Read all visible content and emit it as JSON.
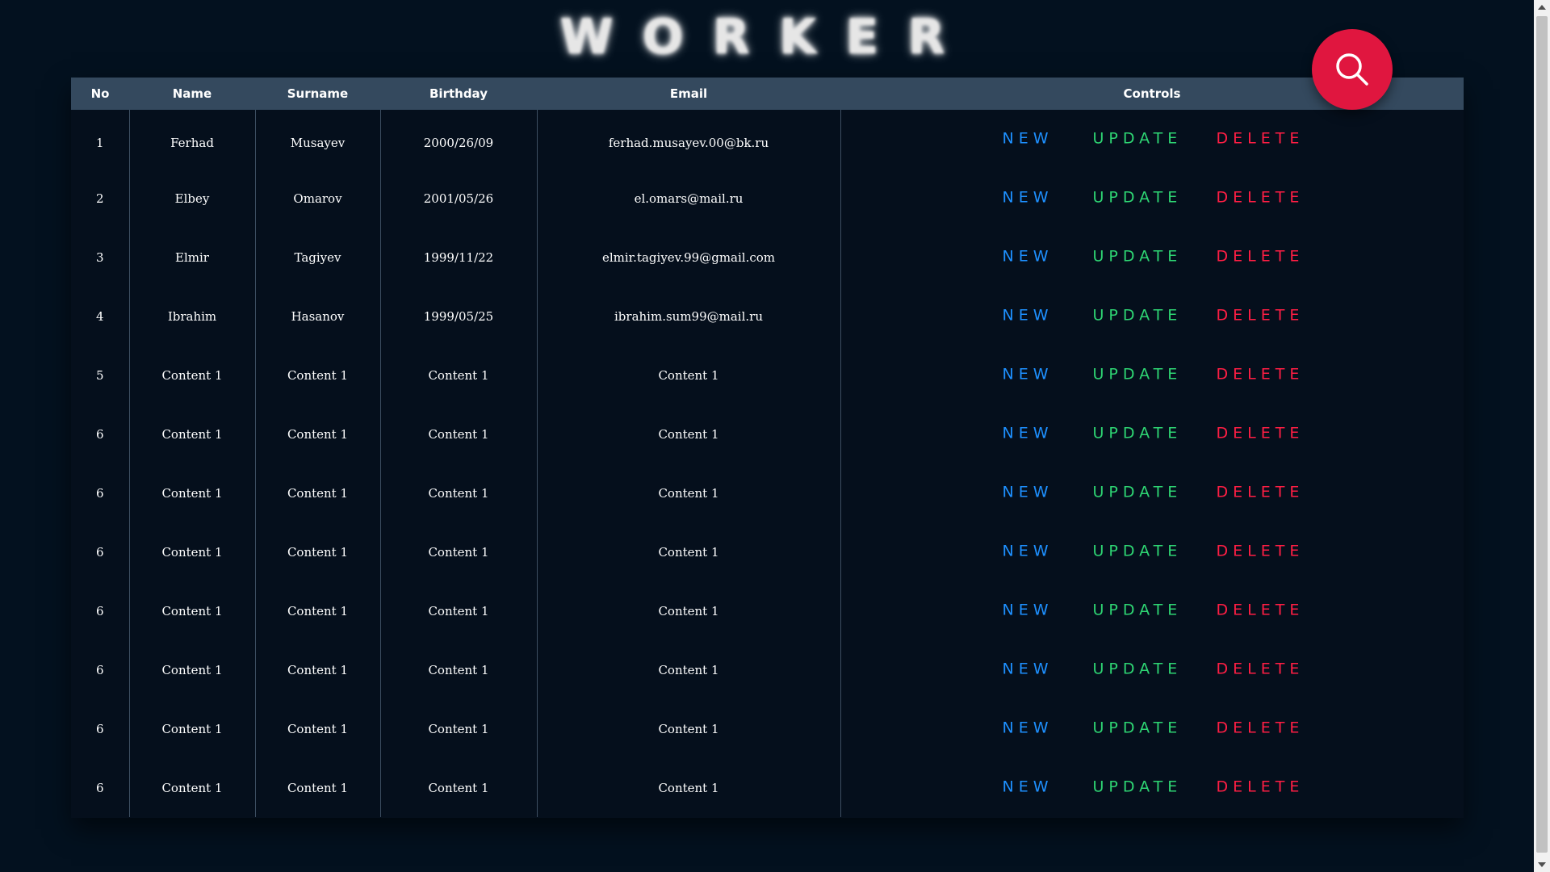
{
  "header": {
    "title": "WORKER"
  },
  "table": {
    "columns": [
      "No",
      "Name",
      "Surname",
      "Birthday",
      "Email",
      "Controls"
    ],
    "rows": [
      {
        "no": "1",
        "name": "Ferhad",
        "surname": "Musayev",
        "birthday": "2000/26/09",
        "email": "ferhad.musayev.00@bk.ru"
      },
      {
        "no": "2",
        "name": "Elbey",
        "surname": "Omarov",
        "birthday": "2001/05/26",
        "email": "el.omars@mail.ru"
      },
      {
        "no": "3",
        "name": "Elmir",
        "surname": "Tagiyev",
        "birthday": "1999/11/22",
        "email": "elmir.tagiyev.99@gmail.com"
      },
      {
        "no": "4",
        "name": "Ibrahim",
        "surname": "Hasanov",
        "birthday": "1999/05/25",
        "email": "ibrahim.sum99@mail.ru"
      },
      {
        "no": "5",
        "name": "Content 1",
        "surname": "Content 1",
        "birthday": "Content 1",
        "email": "Content 1"
      },
      {
        "no": "6",
        "name": "Content 1",
        "surname": "Content 1",
        "birthday": "Content 1",
        "email": "Content 1"
      },
      {
        "no": "6",
        "name": "Content 1",
        "surname": "Content 1",
        "birthday": "Content 1",
        "email": "Content 1"
      },
      {
        "no": "6",
        "name": "Content 1",
        "surname": "Content 1",
        "birthday": "Content 1",
        "email": "Content 1"
      },
      {
        "no": "6",
        "name": "Content 1",
        "surname": "Content 1",
        "birthday": "Content 1",
        "email": "Content 1"
      },
      {
        "no": "6",
        "name": "Content 1",
        "surname": "Content 1",
        "birthday": "Content 1",
        "email": "Content 1"
      },
      {
        "no": "6",
        "name": "Content 1",
        "surname": "Content 1",
        "birthday": "Content 1",
        "email": "Content 1"
      },
      {
        "no": "6",
        "name": "Content 1",
        "surname": "Content 1",
        "birthday": "Content 1",
        "email": "Content 1"
      }
    ]
  },
  "controls": {
    "new_label": "NEW",
    "update_label": "UPDATE",
    "delete_label": "DELETE"
  },
  "search": {
    "icon": "search-icon"
  },
  "colors": {
    "background": "#03111f",
    "header_row": "#34495e",
    "new": "#1e90ff",
    "update": "#2ed573",
    "delete": "#ff1e44",
    "search_button": "#e0163f"
  }
}
